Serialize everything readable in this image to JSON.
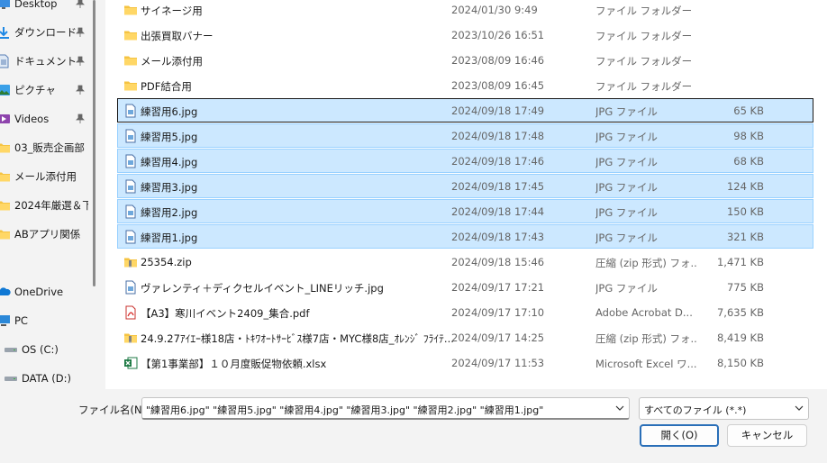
{
  "sidebar": {
    "items": [
      {
        "label": "Desktop",
        "icon": "desktop-icon",
        "pinned": true
      },
      {
        "label": "ダウンロード",
        "icon": "download-icon",
        "pinned": true
      },
      {
        "label": "ドキュメント",
        "icon": "document-icon",
        "pinned": true
      },
      {
        "label": "ピクチャ",
        "icon": "pictures-icon",
        "pinned": true
      },
      {
        "label": "Videos",
        "icon": "videos-icon",
        "pinned": true
      },
      {
        "label": "03_販売企画部",
        "icon": "folder-icon",
        "pinned": false
      },
      {
        "label": "メール添付用",
        "icon": "folder-icon",
        "pinned": false
      },
      {
        "label": "2024年厳選＆下",
        "icon": "folder-icon",
        "pinned": false
      },
      {
        "label": "ABアプリ関係",
        "icon": "folder-icon",
        "pinned": false
      },
      {
        "label": "OneDrive",
        "icon": "onedrive-icon",
        "pinned": false
      },
      {
        "label": "PC",
        "icon": "pc-icon",
        "pinned": false
      },
      {
        "label": "OS (C:)",
        "icon": "drive-icon",
        "pinned": false
      },
      {
        "label": "DATA (D:)",
        "icon": "drive-icon",
        "pinned": false
      }
    ]
  },
  "files": [
    {
      "name": "サイネージ用",
      "date": "2024/01/30 9:49",
      "type": "ファイル フォルダー",
      "size": "",
      "icon": "folder-icon",
      "selected": false
    },
    {
      "name": "出張買取バナー",
      "date": "2023/10/26 16:51",
      "type": "ファイル フォルダー",
      "size": "",
      "icon": "folder-icon",
      "selected": false
    },
    {
      "name": "メール添付用",
      "date": "2023/08/09 16:46",
      "type": "ファイル フォルダー",
      "size": "",
      "icon": "folder-icon",
      "selected": false
    },
    {
      "name": "PDF結合用",
      "date": "2023/08/09 16:45",
      "type": "ファイル フォルダー",
      "size": "",
      "icon": "folder-icon",
      "selected": false
    },
    {
      "name": "練習用6.jpg",
      "date": "2024/09/18 17:49",
      "type": "JPG ファイル",
      "size": "65 KB",
      "icon": "image-file-icon",
      "selected": true
    },
    {
      "name": "練習用5.jpg",
      "date": "2024/09/18 17:48",
      "type": "JPG ファイル",
      "size": "98 KB",
      "icon": "image-file-icon",
      "selected": true
    },
    {
      "name": "練習用4.jpg",
      "date": "2024/09/18 17:46",
      "type": "JPG ファイル",
      "size": "68 KB",
      "icon": "image-file-icon",
      "selected": true
    },
    {
      "name": "練習用3.jpg",
      "date": "2024/09/18 17:45",
      "type": "JPG ファイル",
      "size": "124 KB",
      "icon": "image-file-icon",
      "selected": true
    },
    {
      "name": "練習用2.jpg",
      "date": "2024/09/18 17:44",
      "type": "JPG ファイル",
      "size": "150 KB",
      "icon": "image-file-icon",
      "selected": true
    },
    {
      "name": "練習用1.jpg",
      "date": "2024/09/18 17:43",
      "type": "JPG ファイル",
      "size": "321 KB",
      "icon": "image-file-icon",
      "selected": true
    },
    {
      "name": "25354.zip",
      "date": "2024/09/18 15:46",
      "type": "圧縮 (zip 形式) フォ...",
      "size": "1,471 KB",
      "icon": "zip-folder-icon",
      "selected": false
    },
    {
      "name": "ヴァレンティ＋ディクセルイベント_LINEリッチ.jpg",
      "date": "2024/09/17 17:21",
      "type": "JPG ファイル",
      "size": "775 KB",
      "icon": "image-file-icon",
      "selected": false
    },
    {
      "name": "【A3】寒川イベント2409_集合.pdf",
      "date": "2024/09/17 17:10",
      "type": "Adobe Acrobat D...",
      "size": "7,635 KB",
      "icon": "pdf-icon",
      "selected": false
    },
    {
      "name": "24.9.27ｱｲｴｰ様18店・ﾄｷﾜｵｰﾄｻｰﾋﾞｽ様7店・MYC様8店_ｵﾚﾝｼﾞ ﾌﾗｲﾃ...",
      "date": "2024/09/17 14:25",
      "type": "圧縮 (zip 形式) フォ...",
      "size": "8,419 KB",
      "icon": "zip-folder-icon",
      "selected": false
    },
    {
      "name": "【第1事業部】１０月度販促物依頼.xlsx",
      "date": "2024/09/17 11:53",
      "type": "Microsoft Excel ワ...",
      "size": "8,150 KB",
      "icon": "excel-icon",
      "selected": false
    }
  ],
  "footer": {
    "filename_label": "ファイル名(N):",
    "filename_value": "\"練習用6.jpg\" \"練習用5.jpg\" \"練習用4.jpg\" \"練習用3.jpg\" \"練習用2.jpg\" \"練習用1.jpg\"",
    "filetype_value": "すべてのファイル (*.*)",
    "open_label": "開く(O)",
    "cancel_label": "キャンセル"
  },
  "colors": {
    "selection_bg": "#cce8ff",
    "selection_border": "#99d1ff",
    "folder": "#f5c342",
    "accent": "#2a6fb8"
  }
}
